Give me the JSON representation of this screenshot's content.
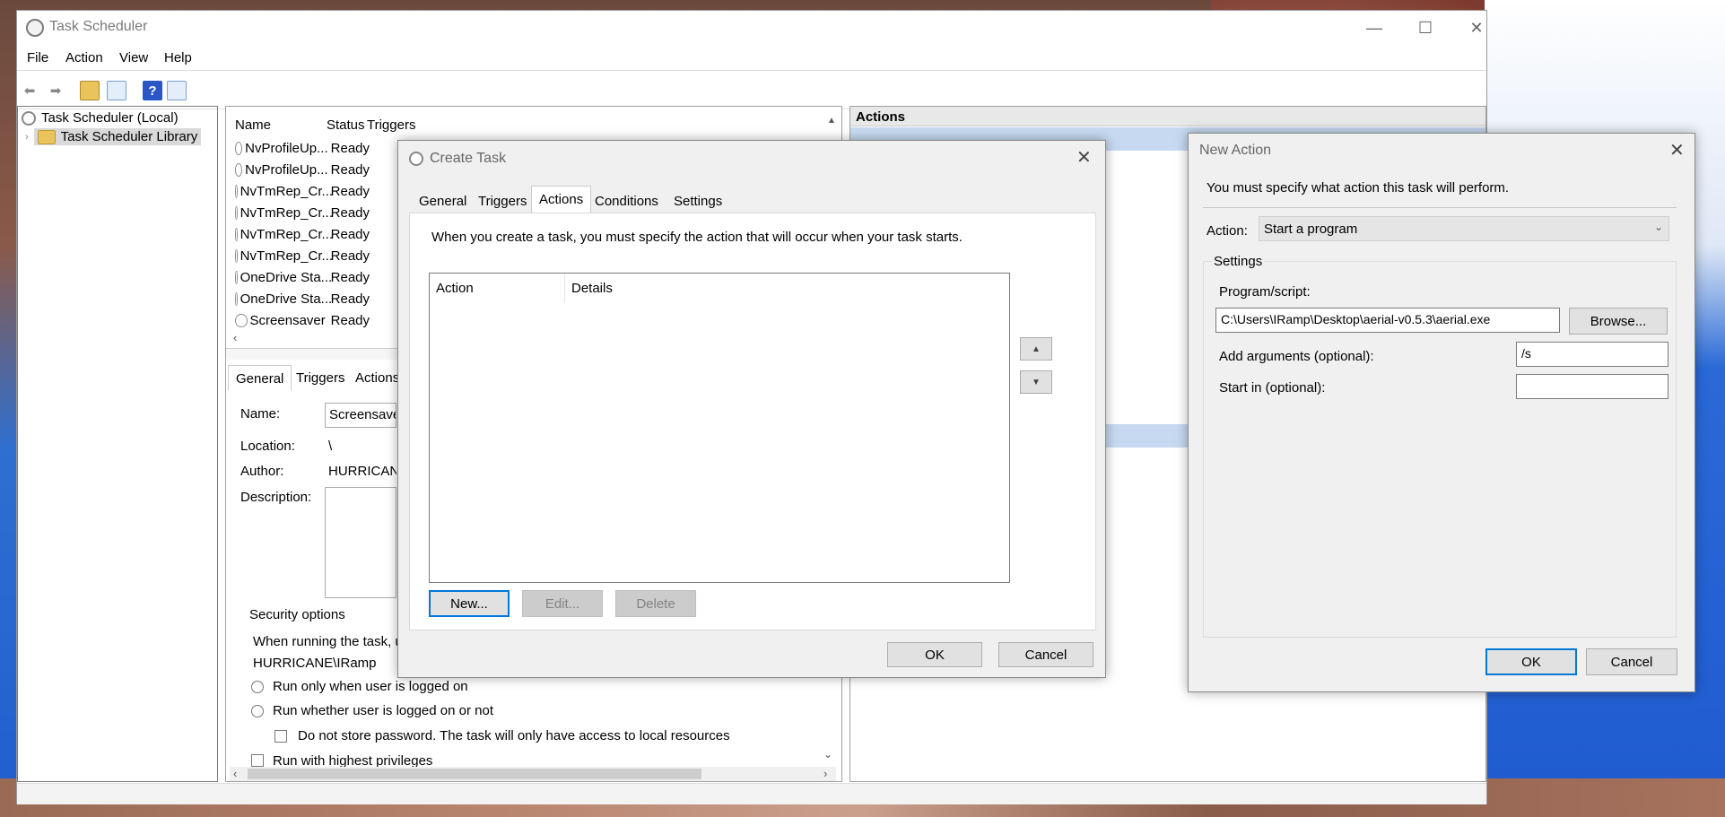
{
  "window": {
    "title": "Task Scheduler",
    "menu": [
      "File",
      "Action",
      "View",
      "Help"
    ]
  },
  "tree": {
    "root": "Task Scheduler (Local)",
    "child": "Task Scheduler Library"
  },
  "tasklist": {
    "headers": [
      "Name",
      "Status",
      "Triggers"
    ],
    "rows": [
      {
        "name": "NvProfileUp...",
        "status": "Ready"
      },
      {
        "name": "NvProfileUp...",
        "status": "Ready"
      },
      {
        "name": "NvTmRep_Cr...",
        "status": "Ready"
      },
      {
        "name": "NvTmRep_Cr...",
        "status": "Ready"
      },
      {
        "name": "NvTmRep_Cr...",
        "status": "Ready"
      },
      {
        "name": "NvTmRep_Cr...",
        "status": "Ready"
      },
      {
        "name": "OneDrive Sta...",
        "status": "Ready"
      },
      {
        "name": "OneDrive Sta...",
        "status": "Ready"
      },
      {
        "name": "Screensaver",
        "status": "Ready"
      }
    ]
  },
  "props": {
    "tabs": [
      "General",
      "Triggers",
      "Actions"
    ],
    "name_label": "Name:",
    "name_value": "Screensaver",
    "location_label": "Location:",
    "location_value": "\\",
    "author_label": "Author:",
    "author_value": "HURRICANE",
    "description_label": "Description:",
    "security_title": "Security options",
    "when_running": "When running the task, u",
    "user_account": "HURRICANE\\IRamp",
    "radio_logged_on": "Run only when user is logged on",
    "radio_whether": "Run whether user is logged on or not",
    "chk_no_store": "Do not store password.  The task will only have access to local resources",
    "chk_highest": "Run with highest privileges"
  },
  "actions_pane": {
    "title": "Actions"
  },
  "create_task": {
    "title": "Create Task",
    "tabs": [
      "General",
      "Triggers",
      "Actions",
      "Conditions",
      "Settings"
    ],
    "intro": "When you create a task, you must specify the action that will occur when your task starts.",
    "col_action": "Action",
    "col_details": "Details",
    "btn_new": "New...",
    "btn_edit": "Edit...",
    "btn_delete": "Delete",
    "btn_ok": "OK",
    "btn_cancel": "Cancel"
  },
  "new_action": {
    "title": "New Action",
    "prompt": "You must specify what action this task will perform.",
    "action_label": "Action:",
    "action_value": "Start a program",
    "settings_label": "Settings",
    "program_label": "Program/script:",
    "program_value": "C:\\Users\\IRamp\\Desktop\\aerial-v0.5.3\\aerial.exe",
    "browse": "Browse...",
    "args_label": "Add arguments (optional):",
    "args_value": "/s",
    "startin_label": "Start in (optional):",
    "startin_value": "",
    "btn_ok": "OK",
    "btn_cancel": "Cancel"
  }
}
